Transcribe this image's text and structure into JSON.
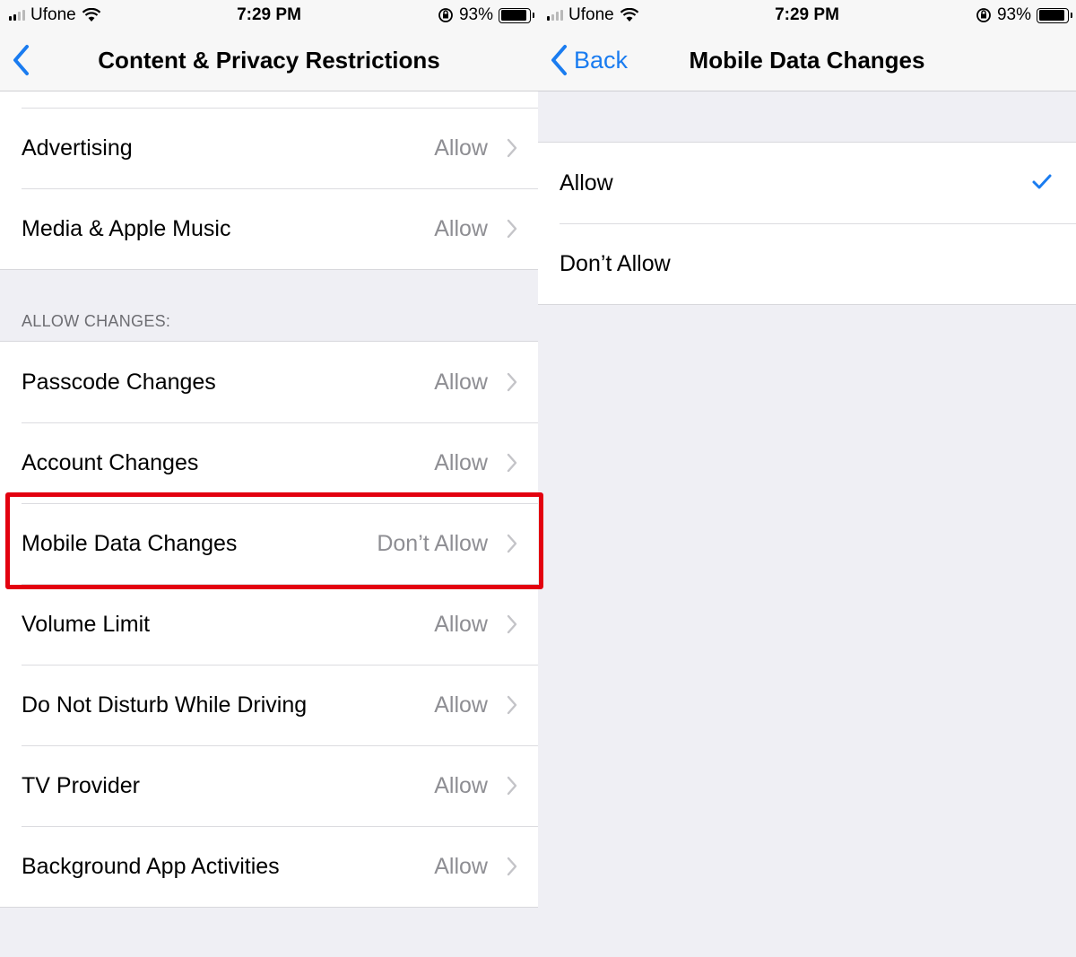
{
  "status_bar": {
    "carrier": "Ufone",
    "time": "7:29 PM",
    "battery_percent_label": "93%",
    "battery_level": 0.93,
    "signal_bars_active": 2,
    "signal_bars_total": 4
  },
  "left_screen": {
    "nav": {
      "back_label": "",
      "title": "Content & Privacy Restrictions"
    },
    "top_group": [
      {
        "label": "Advertising",
        "value": "Allow"
      },
      {
        "label": "Media & Apple Music",
        "value": "Allow"
      }
    ],
    "section_header": "ALLOW CHANGES:",
    "allow_changes_group": [
      {
        "label": "Passcode Changes",
        "value": "Allow"
      },
      {
        "label": "Account Changes",
        "value": "Allow"
      },
      {
        "label": "Mobile Data Changes",
        "value": "Don’t Allow",
        "highlighted": true
      },
      {
        "label": "Volume Limit",
        "value": "Allow"
      },
      {
        "label": "Do Not Disturb While Driving",
        "value": "Allow"
      },
      {
        "label": "TV Provider",
        "value": "Allow"
      },
      {
        "label": "Background App Activities",
        "value": "Allow"
      }
    ]
  },
  "right_screen": {
    "nav": {
      "back_label": "Back",
      "title": "Mobile Data Changes"
    },
    "options": [
      {
        "label": "Allow",
        "selected": true
      },
      {
        "label": "Don’t Allow",
        "selected": false
      }
    ]
  },
  "colors": {
    "accent": "#1a7cf0",
    "highlight_border": "#e3000f",
    "secondary_text": "#8e8e93",
    "grouped_background": "#efeff4"
  }
}
